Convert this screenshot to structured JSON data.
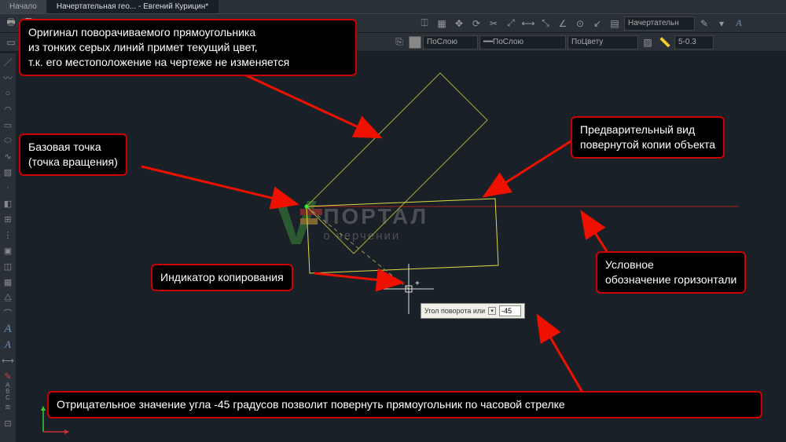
{
  "tabs": {
    "start": "Начало",
    "doc": "Начертательная гео... - Евгений Курицин*"
  },
  "toolbar": {
    "combo_layer": "ПоСлою",
    "combo_layer2": "ПоСлою",
    "combo_color": "ПоЦвету",
    "layer_name": "Начертательн",
    "lineweight": "5-0.3"
  },
  "annotations": {
    "a1": "Оригинал поворачиваемого прямоугольника\nиз тонких серых линий примет текущий цвет,\nт.к. его местоположение на чертеже не изменяется",
    "a2": "Базовая точка\n(точка вращения)",
    "a3": "Предварительный вид\nповернутой копии объекта",
    "a4": "Индикатор копирования",
    "a5": "Условное\nобозначение горизонтали",
    "a6": "Отрицательное значение угла -45 градусов позволит повернуть прямоугольник по часовой стрелке"
  },
  "input": {
    "label": "Угол поворота или",
    "value": "-45"
  },
  "watermark": {
    "t1": "ПОРТАЛ",
    "t2": "о черчении"
  }
}
